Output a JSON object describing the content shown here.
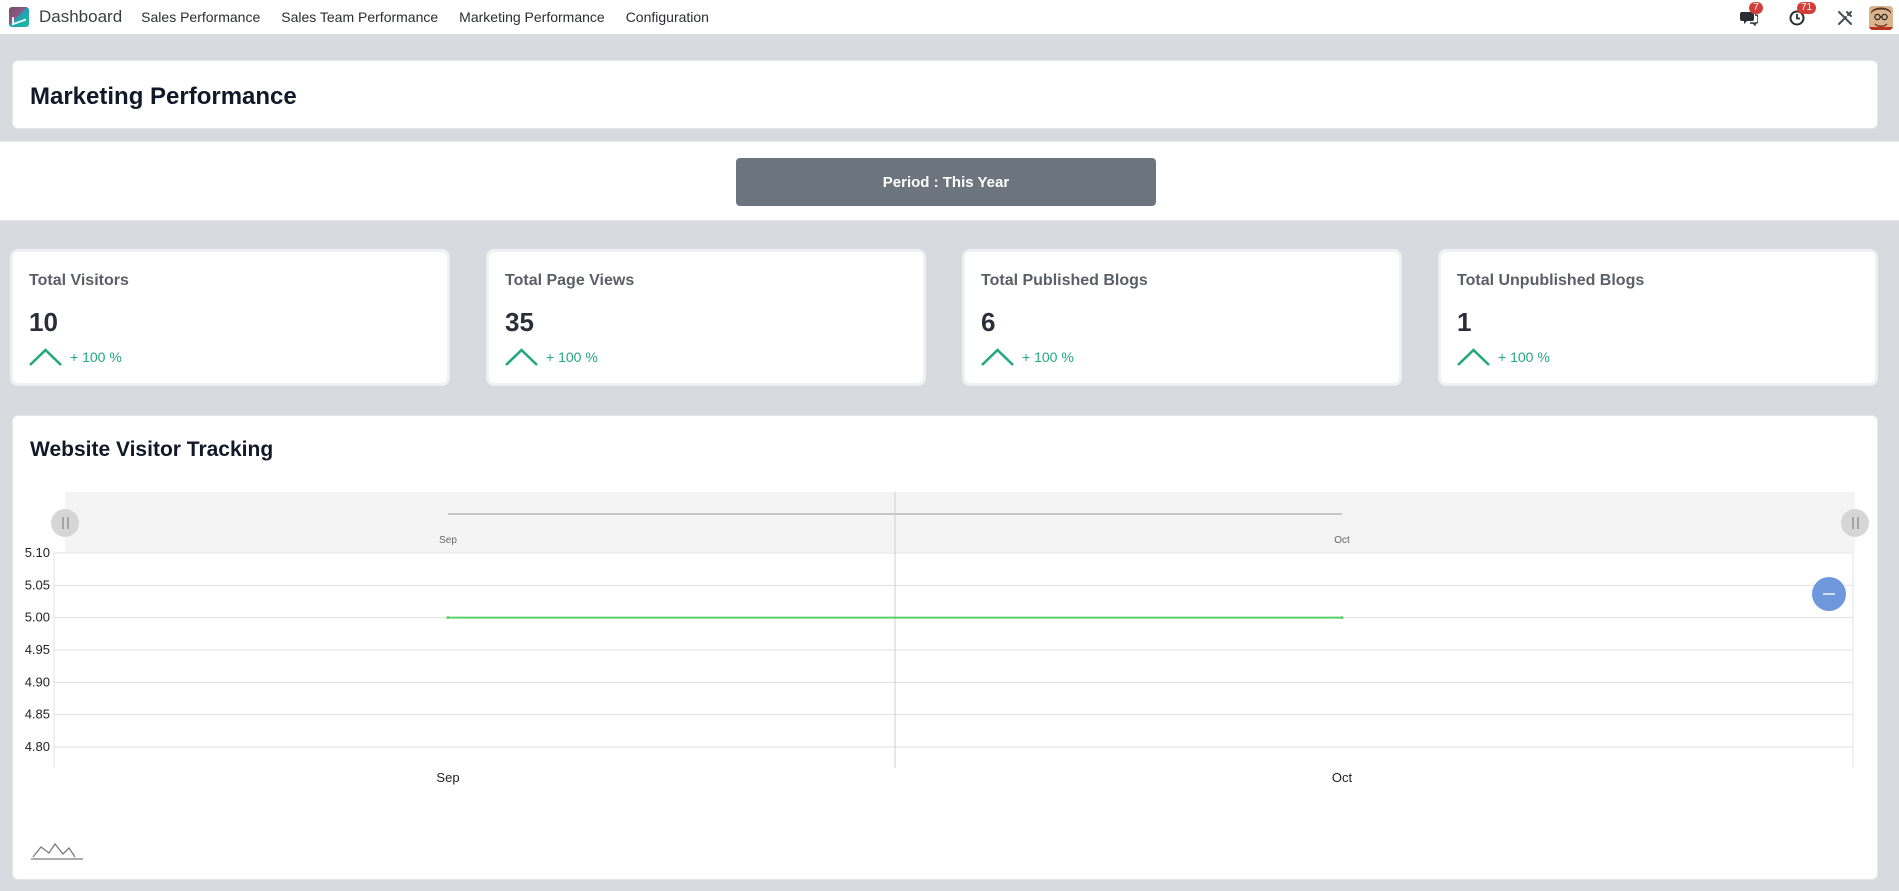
{
  "navbar": {
    "app_title": "Dashboard",
    "menu": [
      "Sales Performance",
      "Sales Team Performance",
      "Marketing Performance",
      "Configuration"
    ],
    "messages_badge": "7",
    "activities_badge": "71"
  },
  "page": {
    "title": "Marketing Performance",
    "period_label": "Period : This Year"
  },
  "kpis": [
    {
      "title": "Total Visitors",
      "value": "10",
      "trend": "+ 100 %"
    },
    {
      "title": "Total Page Views",
      "value": "35",
      "trend": "+ 100 %"
    },
    {
      "title": "Total Published Blogs",
      "value": "6",
      "trend": "+ 100 %"
    },
    {
      "title": "Total Unpublished Blogs",
      "value": "1",
      "trend": "+ 100 %"
    }
  ],
  "colors": {
    "trend_up": "#21a97a",
    "series_line": "#5ad16a",
    "zoom_button": "#6e97dc"
  },
  "chart": {
    "title": "Website Visitor Tracking"
  },
  "chart_data": {
    "type": "line",
    "title": "Website Visitor Tracking",
    "x": [
      "Sep",
      "Oct"
    ],
    "series": [
      {
        "values": [
          5.0,
          5.0
        ]
      }
    ],
    "ylim": [
      4.8,
      5.1
    ],
    "yticks": [
      "5.10",
      "5.05",
      "5.00",
      "4.95",
      "4.90",
      "4.85",
      "4.80"
    ],
    "grid": true,
    "navigator_labels": [
      "Sep",
      "Oct"
    ]
  }
}
